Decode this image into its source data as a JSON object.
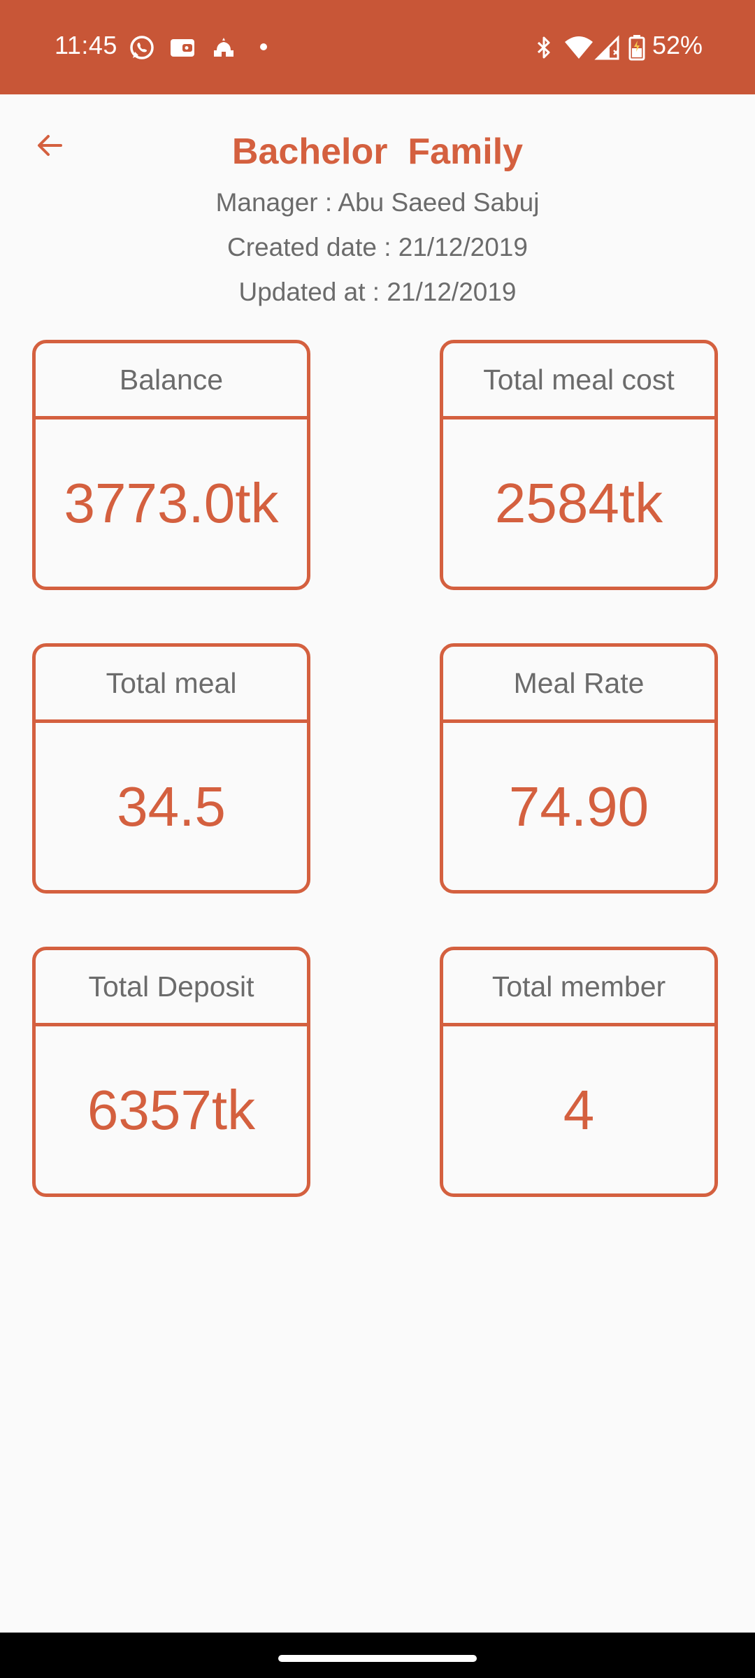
{
  "status_bar": {
    "time": "11:45",
    "battery": "52%",
    "icons": [
      "whatsapp-icon",
      "wallet-icon",
      "mosque-icon",
      "bluetooth-icon",
      "wifi-icon",
      "signal-icon",
      "battery-icon"
    ],
    "background_color": "#c85637"
  },
  "header": {
    "back_icon": "arrow-left-icon",
    "title": "Bachelor  Family",
    "manager": "Manager : Abu Saeed Sabuj",
    "created": "Created date : 21/12/2019",
    "updated": "Updated at : 21/12/2019"
  },
  "stats": [
    {
      "label": "Balance",
      "value": "3773.0tk"
    },
    {
      "label": "Total meal cost",
      "value": "2584tk"
    },
    {
      "label": "Total meal",
      "value": "34.5"
    },
    {
      "label": "Meal Rate",
      "value": "74.90"
    },
    {
      "label": "Total Deposit",
      "value": "6357tk"
    },
    {
      "label": "Total member",
      "value": "4"
    }
  ],
  "accent_color": "#d4603f"
}
